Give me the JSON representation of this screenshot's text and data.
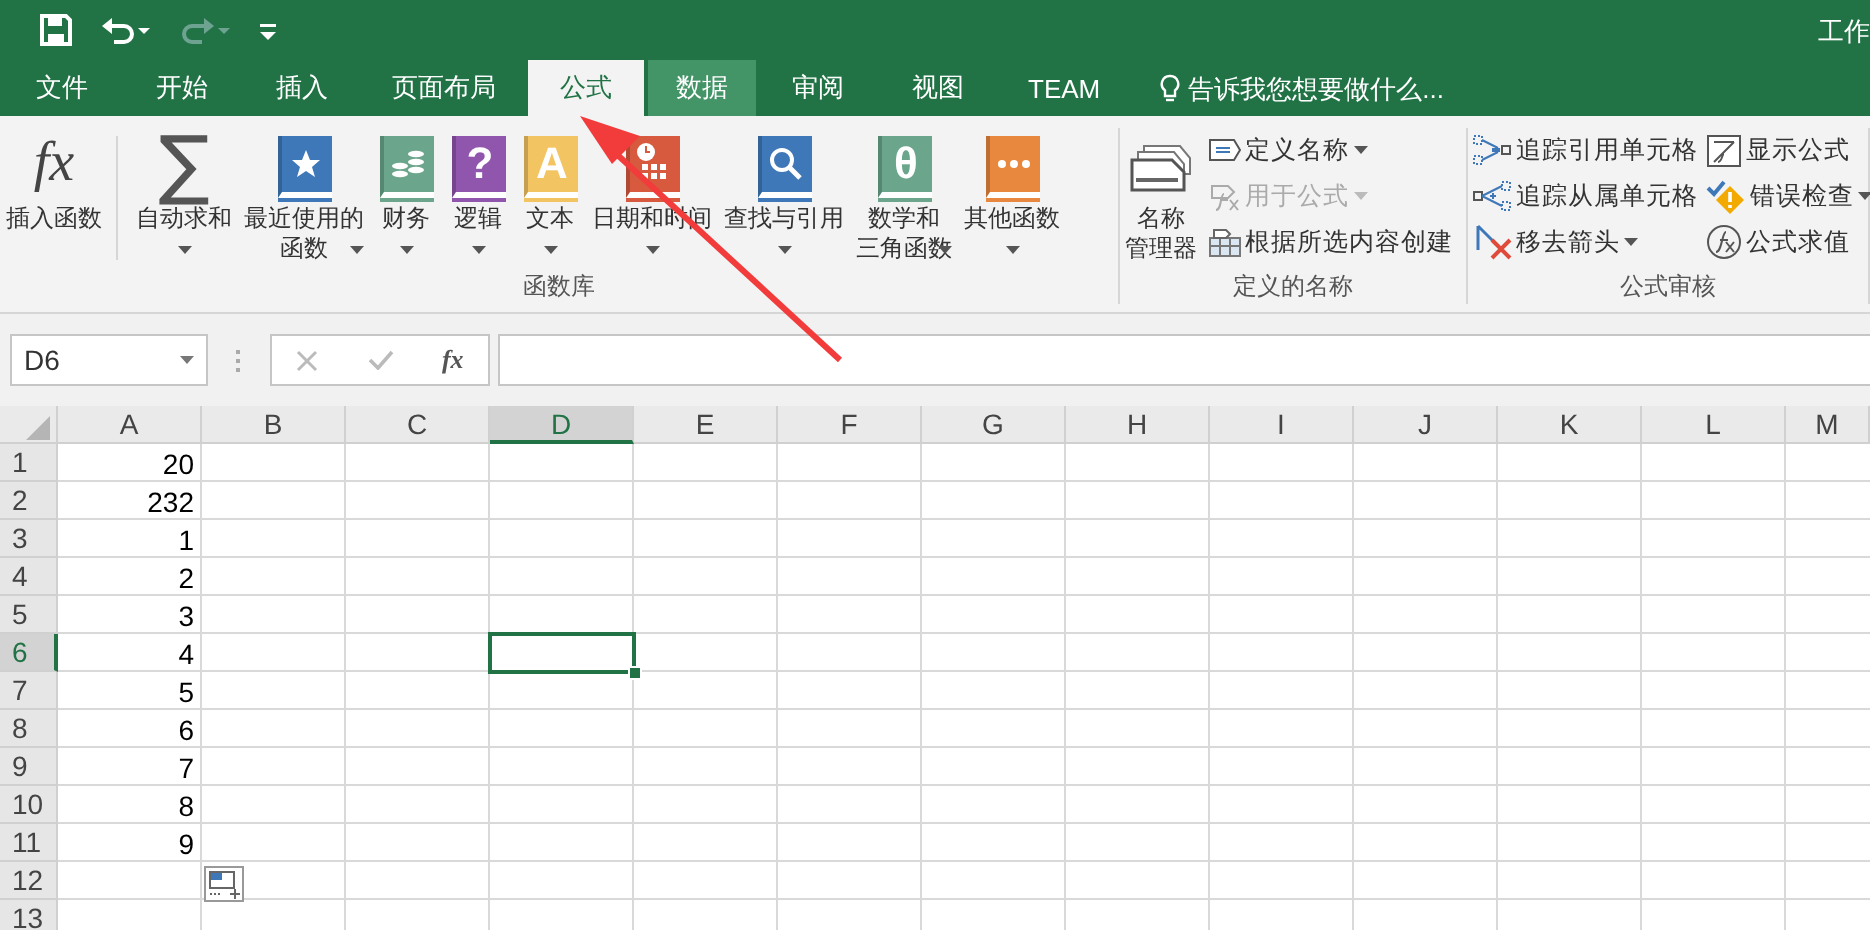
{
  "title_bar": {
    "title": "工作"
  },
  "tabs": [
    {
      "label": "文件",
      "selected": false,
      "hovered": false
    },
    {
      "label": "开始",
      "selected": false,
      "hovered": false
    },
    {
      "label": "插入",
      "selected": false,
      "hovered": false
    },
    {
      "label": "页面布局",
      "selected": false,
      "hovered": false
    },
    {
      "label": "公式",
      "selected": true,
      "hovered": false
    },
    {
      "label": "数据",
      "selected": false,
      "hovered": true
    },
    {
      "label": "审阅",
      "selected": false,
      "hovered": false
    },
    {
      "label": "视图",
      "selected": false,
      "hovered": false
    },
    {
      "label": "TEAM",
      "selected": false,
      "hovered": false
    }
  ],
  "tell_me": {
    "placeholder": "告诉我您想要做什么..."
  },
  "ribbon": {
    "groups": [
      {
        "label": "函数库",
        "items": [
          {
            "kind": "glyph-fx",
            "glyph": "fx",
            "lines": [
              "插入函数"
            ],
            "dropdown": false
          },
          {
            "kind": "glyph-sum",
            "glyph": "∑",
            "lines": [
              "自动求和"
            ],
            "dropdown": true
          },
          {
            "kind": "book-star",
            "color": "#3f78b8",
            "lines": [
              "最近使用的",
              "函数"
            ],
            "dropdown": true
          },
          {
            "kind": "book-coins",
            "color": "#6aa58c",
            "lines": [
              "财务"
            ],
            "dropdown": true
          },
          {
            "kind": "book-glyph",
            "color": "#9055ad",
            "glyph": "?",
            "lines": [
              "逻辑"
            ],
            "dropdown": true
          },
          {
            "kind": "book-glyph",
            "color": "#f2c462",
            "glyph": "A",
            "lines": [
              "文本"
            ],
            "dropdown": true
          },
          {
            "kind": "book-calendar",
            "color": "#d75a3f",
            "lines": [
              "日期和时间"
            ],
            "dropdown": true
          },
          {
            "kind": "book-search",
            "color": "#3f78b8",
            "lines": [
              "查找与引用"
            ],
            "dropdown": true
          },
          {
            "kind": "book-glyph",
            "color": "#6aa58c",
            "glyph": "θ",
            "lines": [
              "数学和",
              "三角函数"
            ],
            "dropdown": true
          },
          {
            "kind": "book-dots",
            "color": "#e8873e",
            "lines": [
              "其他函数"
            ],
            "dropdown": true
          }
        ]
      },
      {
        "label": "定义的名称",
        "items": [
          {
            "kind": "name-manager",
            "lines": [
              "名称",
              "管理器"
            ],
            "dropdown": false
          }
        ],
        "small_columns": [
          [
            {
              "kind": "name-tag",
              "label": "定义名称",
              "dropdown": true,
              "disabled": false
            },
            {
              "kind": "fx-tag",
              "label": "用于公式",
              "dropdown": true,
              "disabled": true
            },
            {
              "kind": "create-table",
              "label": "根据所选内容创建",
              "dropdown": false,
              "disabled": false
            }
          ]
        ]
      },
      {
        "label": "公式审核",
        "small_columns": [
          [
            {
              "kind": "trace-precedents",
              "label": "追踪引用单元格",
              "dropdown": false,
              "disabled": false
            },
            {
              "kind": "trace-dependents",
              "label": "追踪从属单元格",
              "dropdown": false,
              "disabled": false
            },
            {
              "kind": "remove-arrows",
              "label": "移去箭头",
              "dropdown": true,
              "disabled": false
            }
          ],
          [
            {
              "kind": "show-formulas",
              "label": "显示公式",
              "dropdown": false,
              "disabled": false
            },
            {
              "kind": "error-check",
              "label": "错误检查",
              "dropdown": true,
              "disabled": false
            },
            {
              "kind": "evaluate",
              "label": "公式求值",
              "dropdown": false,
              "disabled": false
            }
          ]
        ]
      }
    ]
  },
  "formula_bar": {
    "name_box": "D6",
    "fx": "fx"
  },
  "sheet": {
    "columns": [
      {
        "label": "A",
        "selected": false
      },
      {
        "label": "B",
        "selected": false
      },
      {
        "label": "C",
        "selected": false
      },
      {
        "label": "D",
        "selected": true
      },
      {
        "label": "E",
        "selected": false
      },
      {
        "label": "F",
        "selected": false
      },
      {
        "label": "G",
        "selected": false
      },
      {
        "label": "H",
        "selected": false
      },
      {
        "label": "I",
        "selected": false
      },
      {
        "label": "J",
        "selected": false
      },
      {
        "label": "K",
        "selected": false
      },
      {
        "label": "L",
        "selected": false
      },
      {
        "label": "M",
        "selected": false
      }
    ],
    "rows": [
      {
        "header": "1",
        "selected": false,
        "value": "20"
      },
      {
        "header": "2",
        "selected": false,
        "value": "232"
      },
      {
        "header": "3",
        "selected": false,
        "value": "1"
      },
      {
        "header": "4",
        "selected": false,
        "value": "2"
      },
      {
        "header": "5",
        "selected": false,
        "value": "3"
      },
      {
        "header": "6",
        "selected": true,
        "value": "4"
      },
      {
        "header": "7",
        "selected": false,
        "value": "5"
      },
      {
        "header": "8",
        "selected": false,
        "value": "6"
      },
      {
        "header": "9",
        "selected": false,
        "value": "7"
      },
      {
        "header": "10",
        "selected": false,
        "value": "8"
      },
      {
        "header": "11",
        "selected": false,
        "value": "9"
      },
      {
        "header": "12",
        "selected": false
      },
      {
        "header": "13",
        "selected": false
      }
    ]
  }
}
